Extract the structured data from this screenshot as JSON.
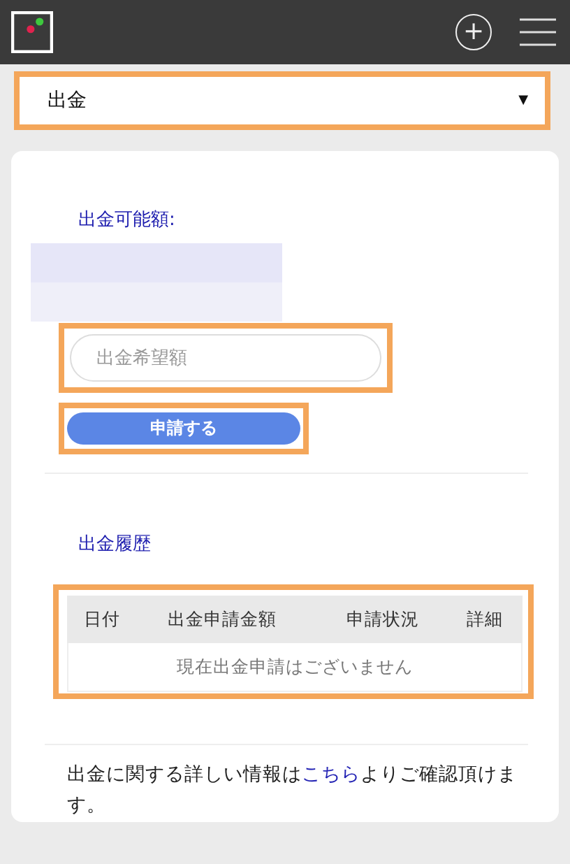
{
  "header": {
    "actions": [
      "+"
    ]
  },
  "select": {
    "value": "出金",
    "arrow": "▼"
  },
  "balance": {
    "label": "出金可能額:"
  },
  "amount_input": {
    "placeholder": "出金希望額"
  },
  "submit_button": "申請する",
  "history": {
    "title": "出金履歴",
    "columns": [
      "日付",
      "出金申請金額",
      "申請状況",
      "詳細"
    ],
    "empty_message": "現在出金申請はございません"
  },
  "info": {
    "before": "出金に関する詳しい情報は",
    "link": "こちら",
    "after": "よりご確認頂けます。"
  }
}
